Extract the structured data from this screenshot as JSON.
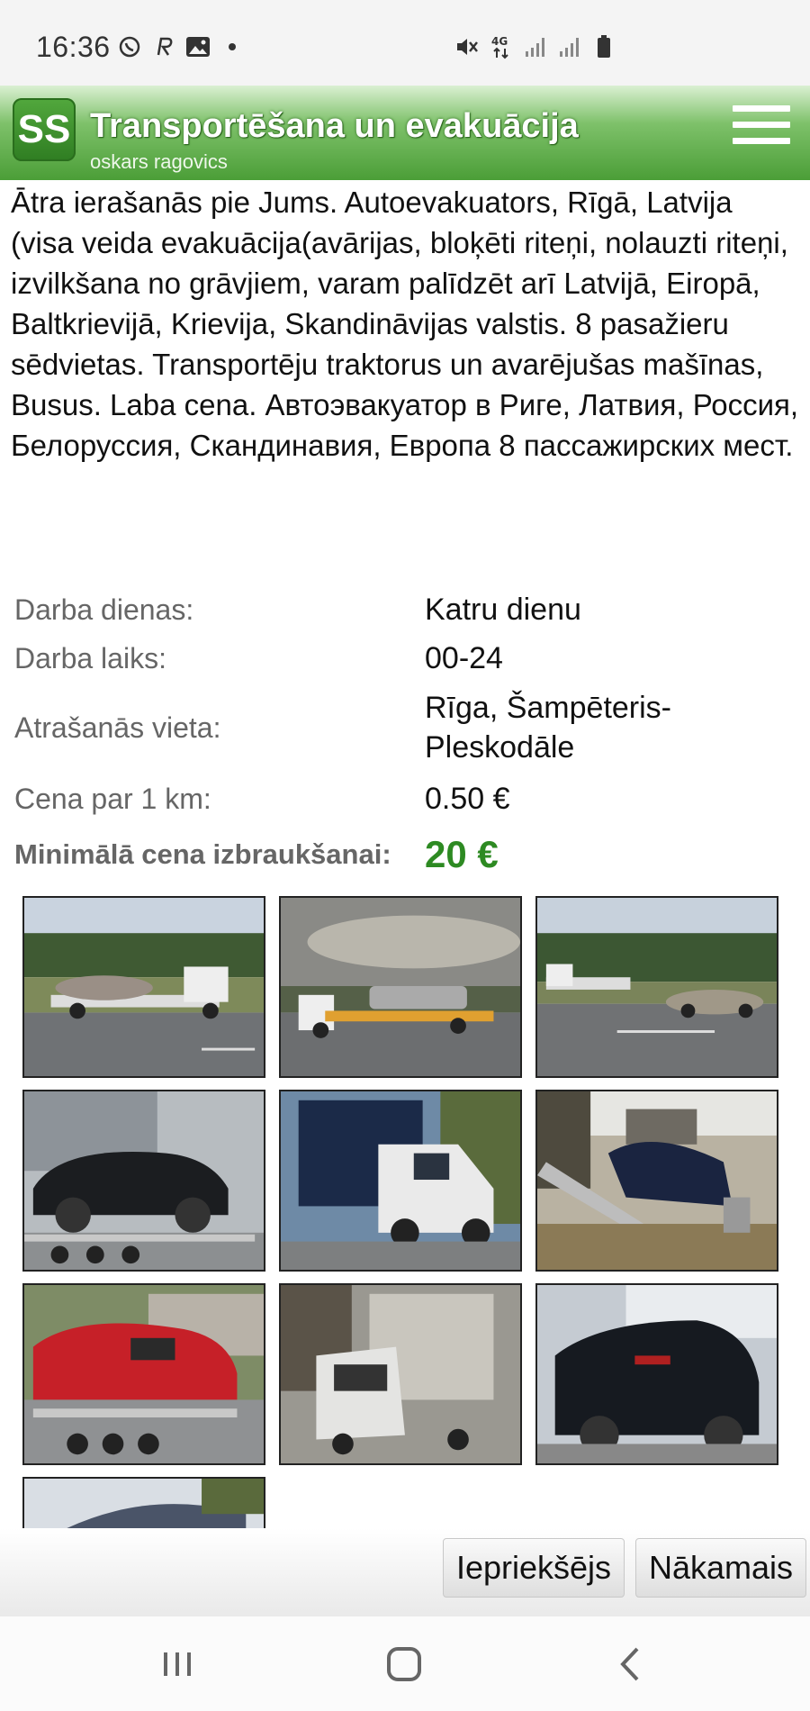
{
  "status_bar": {
    "time": "16:36",
    "left_icons": [
      "whatsapp-icon",
      "r-app-icon",
      "gallery-icon",
      "dot-icon"
    ],
    "right_icons": [
      "mute-icon",
      "4g-icon",
      "signal-icon",
      "signal-icon",
      "battery-icon"
    ]
  },
  "header": {
    "logo_text": "SS",
    "title": "Transportēšana un evakuācija",
    "subtitle": "oskars ragovics"
  },
  "description": "Ātra ierašanās pie Jums. Autoevakuators, Rīgā, Latvija (visa veida evakuācija(avārijas, bloķēti riteņi, nolauzti riteņi, izvilkšana no grāvjiem, varam palīdzēt arī Latvijā, Eiropā, Baltkrievijā, Krievija, Skandināvijas valstis. 8 pasažieru sēdvietas. Transportēju traktorus un avarējušas mašīnas, Busus. Laba cena. Автоэвакуатор в Риге, Латвия, Россия, Белоруссия, Скандинавия, Европа 8 пассажирских мест.",
  "info": {
    "work_days_label": "Darba dienas:",
    "work_days_value": "Katru dienu",
    "work_hours_label": "Darba laiks:",
    "work_hours_value": "00-24",
    "location_label": "Atrašanās vieta:",
    "location_value": "Rīga, Šampēteris-Pleskodāle",
    "price_km_label": "Cena par 1 km:",
    "price_km_value": "0.50 €",
    "min_price_label": "Minimālā cena izbraukšanai:",
    "min_price_value": "20 €"
  },
  "colors": {
    "accent_green": "#4b9e37",
    "price_green": "#2d8a22"
  },
  "actions": {
    "prev_label": "Iepriekšējs",
    "next_label": "Nākamais"
  },
  "navbar": {
    "icons": [
      "recent-apps-icon",
      "home-icon",
      "back-icon"
    ]
  }
}
